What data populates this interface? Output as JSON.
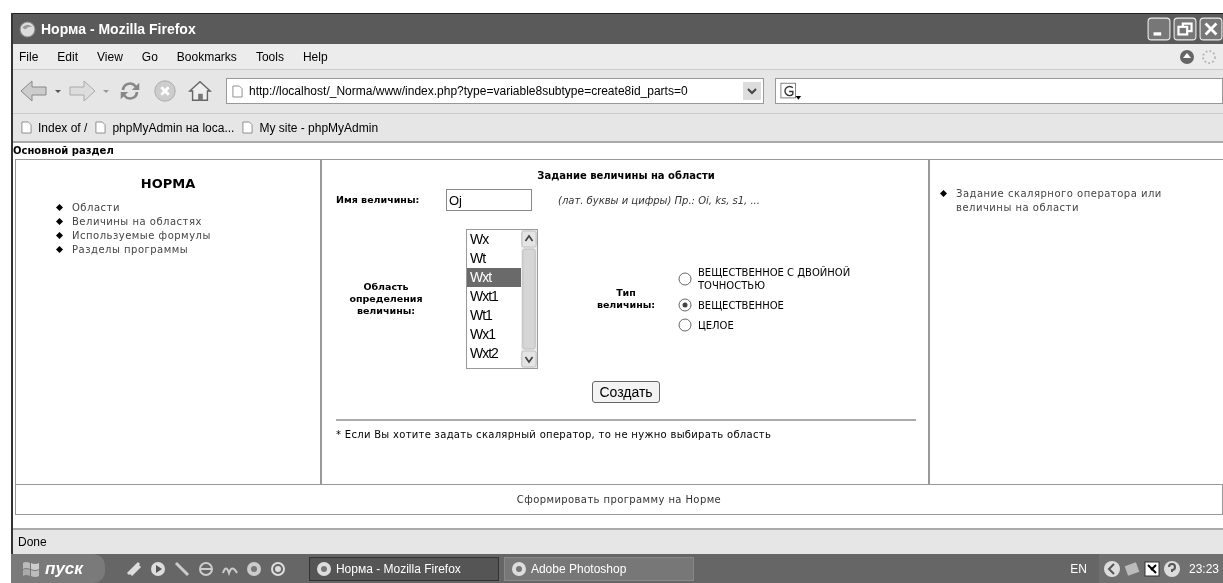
{
  "window": {
    "title": "Норма - Mozilla Firefox"
  },
  "menu": [
    "File",
    "Edit",
    "View",
    "Go",
    "Bookmarks",
    "Tools",
    "Help"
  ],
  "address": {
    "url": "http://localhost/_Norma/www/index.php?type=variable8subtype=create8id_parts=0"
  },
  "bookmarks": [
    "Index of /",
    "phpMyAdmin на loca...",
    "My site - phpMyAdmin"
  ],
  "page": {
    "section_title": "Основной раздел",
    "sidebar": {
      "title": "НОРМА",
      "items": [
        "Области",
        "Величины на областях",
        "Используемые формулы",
        "Разделы программы"
      ]
    },
    "form": {
      "heading": "Задание величины на области",
      "name_label": "Имя величины:",
      "name_value": "Oj",
      "name_hint": "(лат. буквы и цифры) Пр.: Oi, ks, s1, ...",
      "domain_label": "Область определения величины:",
      "domains": [
        {
          "label": "Wx",
          "selected": false
        },
        {
          "label": "Wt",
          "selected": false
        },
        {
          "label": "Wxt",
          "selected": true
        },
        {
          "label": "Wxt1",
          "selected": false
        },
        {
          "label": "Wt1",
          "selected": false
        },
        {
          "label": "Wx1",
          "selected": false
        },
        {
          "label": "Wxt2",
          "selected": false
        }
      ],
      "type_label": "Тип величины:",
      "types": [
        {
          "label": "ВЕЩЕСТВЕННОЕ С ДВОЙНОЙ ТОЧНОСТЬЮ",
          "selected": false
        },
        {
          "label": "ВЕЩЕСТВЕННОЕ",
          "selected": true
        },
        {
          "label": "ЦЕЛОЕ",
          "selected": false
        }
      ],
      "submit": "Создать",
      "note": "* Если Вы хотите задать скалярный оператор, то не нужно выбирать область"
    },
    "right_links": [
      "Задание скалярного оператора или величины на области"
    ],
    "footer_link": "Сформировать программу на Норме"
  },
  "status_bar": "Done",
  "taskbar": {
    "start": "пуск",
    "tasks": [
      {
        "label": "Норма - Mozilla Firefox",
        "selected": true
      },
      {
        "label": "Adobe Photoshop",
        "selected": false
      }
    ],
    "language": "EN",
    "clock": "23:23"
  }
}
